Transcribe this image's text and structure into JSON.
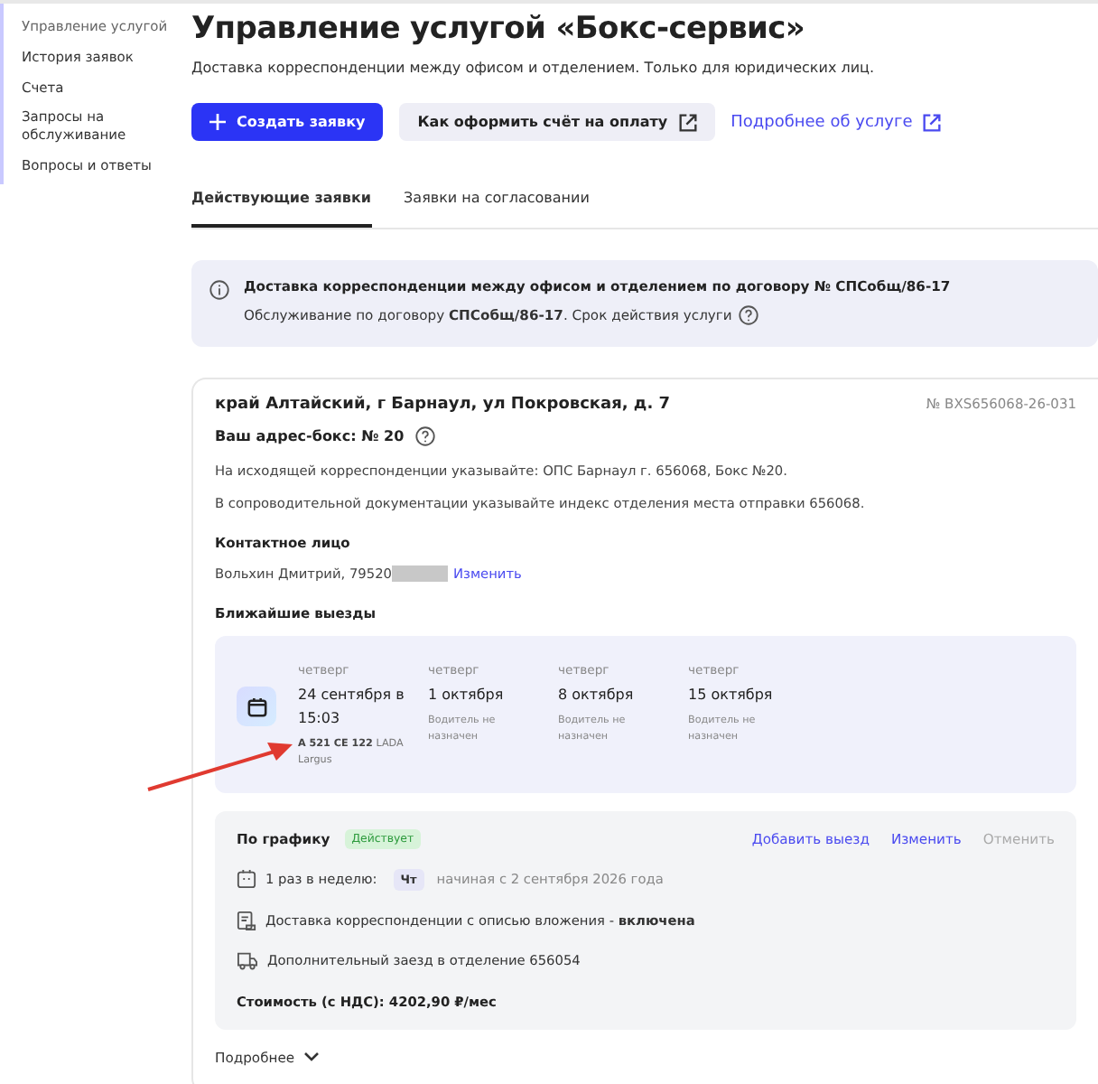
{
  "sidebar": {
    "items": [
      {
        "label": "Управление услугой",
        "selected": true
      },
      {
        "label": "История заявок",
        "selected": false
      },
      {
        "label": "Счета",
        "selected": false
      },
      {
        "label": "Запросы на обслуживание",
        "selected": false
      },
      {
        "label": "Вопросы и ответы",
        "selected": false
      }
    ]
  },
  "header": {
    "title": "Управление услугой «Бокс-сервис»",
    "subtitle": "Доставка корреспонденции между офисом и отделением. Только для юридических лиц.",
    "buttons": [
      {
        "kind": "primary",
        "label": "Создать заявку"
      },
      {
        "kind": "secondary",
        "label": "Как оформить счёт на оплату"
      },
      {
        "kind": "link",
        "label": "Подробнее об услуге"
      }
    ]
  },
  "tabs": [
    {
      "label": "Действующие заявки",
      "selected": true
    },
    {
      "label": "Заявки на согласовании",
      "selected": false
    }
  ],
  "info_banner": {
    "title": "Доставка корреспонденции между офисом и отделением по договору № СПСобщ/86-17",
    "text": "Обслуживание по договору **СПСобщ/86-17**. Срок действия услуги"
  },
  "card": {
    "address": "край Алтайский, г Барнаул, ул Покровская, д. 7",
    "number": "№ BXS656068-26-031",
    "box_label": "Ваш адрес-бокс: № 20",
    "notes": [
      "На исходящей корреспонденции указывайте: ОПС Барнаул г. 656068, Бокс №20.",
      "В сопроводительной документации указывайте индекс отделения места отправки 656068."
    ],
    "contact_heading": "Контактное лицо",
    "contact": "Вольхин Дмитрий, 79520",
    "contact_link": "Изменить",
    "trips_heading": "Ближайшие выезды",
    "trips": [
      {
        "kind": "assigned",
        "day": "четверг",
        "date": "24 сентября в 15:03",
        "vehicle": "**А 521 СЕ 122** LADA Largus"
      },
      {
        "kind": "unassigned",
        "day": "четверг",
        "date": "1 октября",
        "driver": "Водитель не назначен"
      },
      {
        "kind": "unassigned",
        "day": "четверг",
        "date": "8 октября",
        "driver": "Водитель не назначен"
      },
      {
        "kind": "unassigned",
        "day": "четверг",
        "date": "15 октября",
        "driver": "Водитель не назначен"
      }
    ],
    "schedule": {
      "title": "По графику",
      "status": "Действует",
      "actions": [
        {
          "label": "Добавить выезд",
          "disabled": false
        },
        {
          "label": "Изменить",
          "disabled": false
        },
        {
          "label": "Отменить",
          "disabled": true
        }
      ],
      "items": [
        {
          "kind": "calendar",
          "text": "1 раз в неделю:",
          "chip": "Чт",
          "note": "начиная с 2 сентября 2026 года"
        },
        {
          "kind": "inventory",
          "text": "Доставка корреспонденции с описью вложения - **включена**"
        },
        {
          "kind": "truck",
          "text": "Дополнительный заезд в отделение 656054"
        }
      ],
      "cost": "Стоимость (с НДС): 4202,90 ₽/мес"
    },
    "more": "Подробнее"
  }
}
